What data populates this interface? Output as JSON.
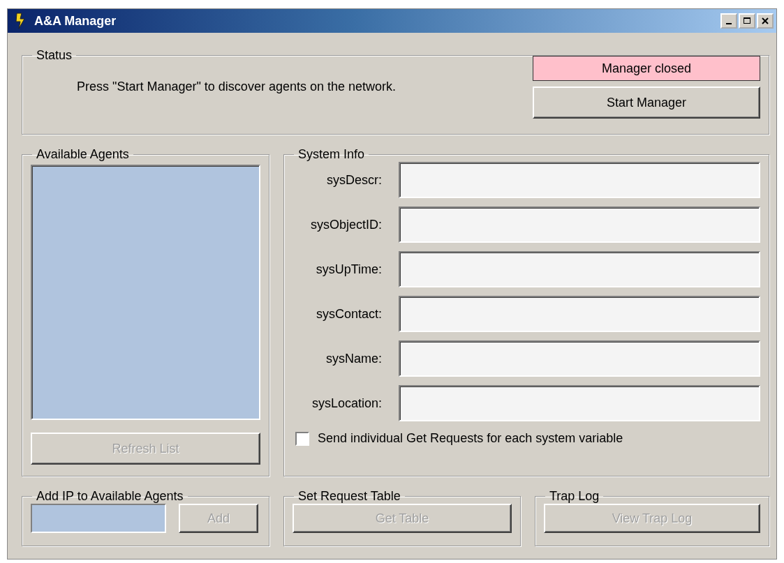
{
  "window": {
    "title": "A&A Manager"
  },
  "status": {
    "legend": "Status",
    "message": "Press \"Start Manager\" to discover agents on the network.",
    "indicator": "Manager closed",
    "button": {
      "label": "Start Manager",
      "disabled": false
    }
  },
  "agents": {
    "legend": "Available Agents",
    "button": {
      "label": "Refresh List",
      "disabled": true
    }
  },
  "system_info": {
    "legend": "System Info",
    "fields": [
      {
        "label": "sysDescr:"
      },
      {
        "label": "sysObjectID:"
      },
      {
        "label": "sysUpTime:"
      },
      {
        "label": "sysContact:"
      },
      {
        "label": "sysName:"
      },
      {
        "label": "sysLocation:"
      }
    ],
    "checkbox": {
      "label": "Send individual Get Requests for each system variable",
      "checked": false
    }
  },
  "add_ip": {
    "legend": "Add IP to Available Agents",
    "button": {
      "label": "Add",
      "disabled": true
    }
  },
  "request_table": {
    "legend": "Set Request Table",
    "button": {
      "label": "Get Table",
      "disabled": true
    }
  },
  "trap_log": {
    "legend": "Trap Log",
    "button": {
      "label": "View Trap Log",
      "disabled": true
    }
  }
}
